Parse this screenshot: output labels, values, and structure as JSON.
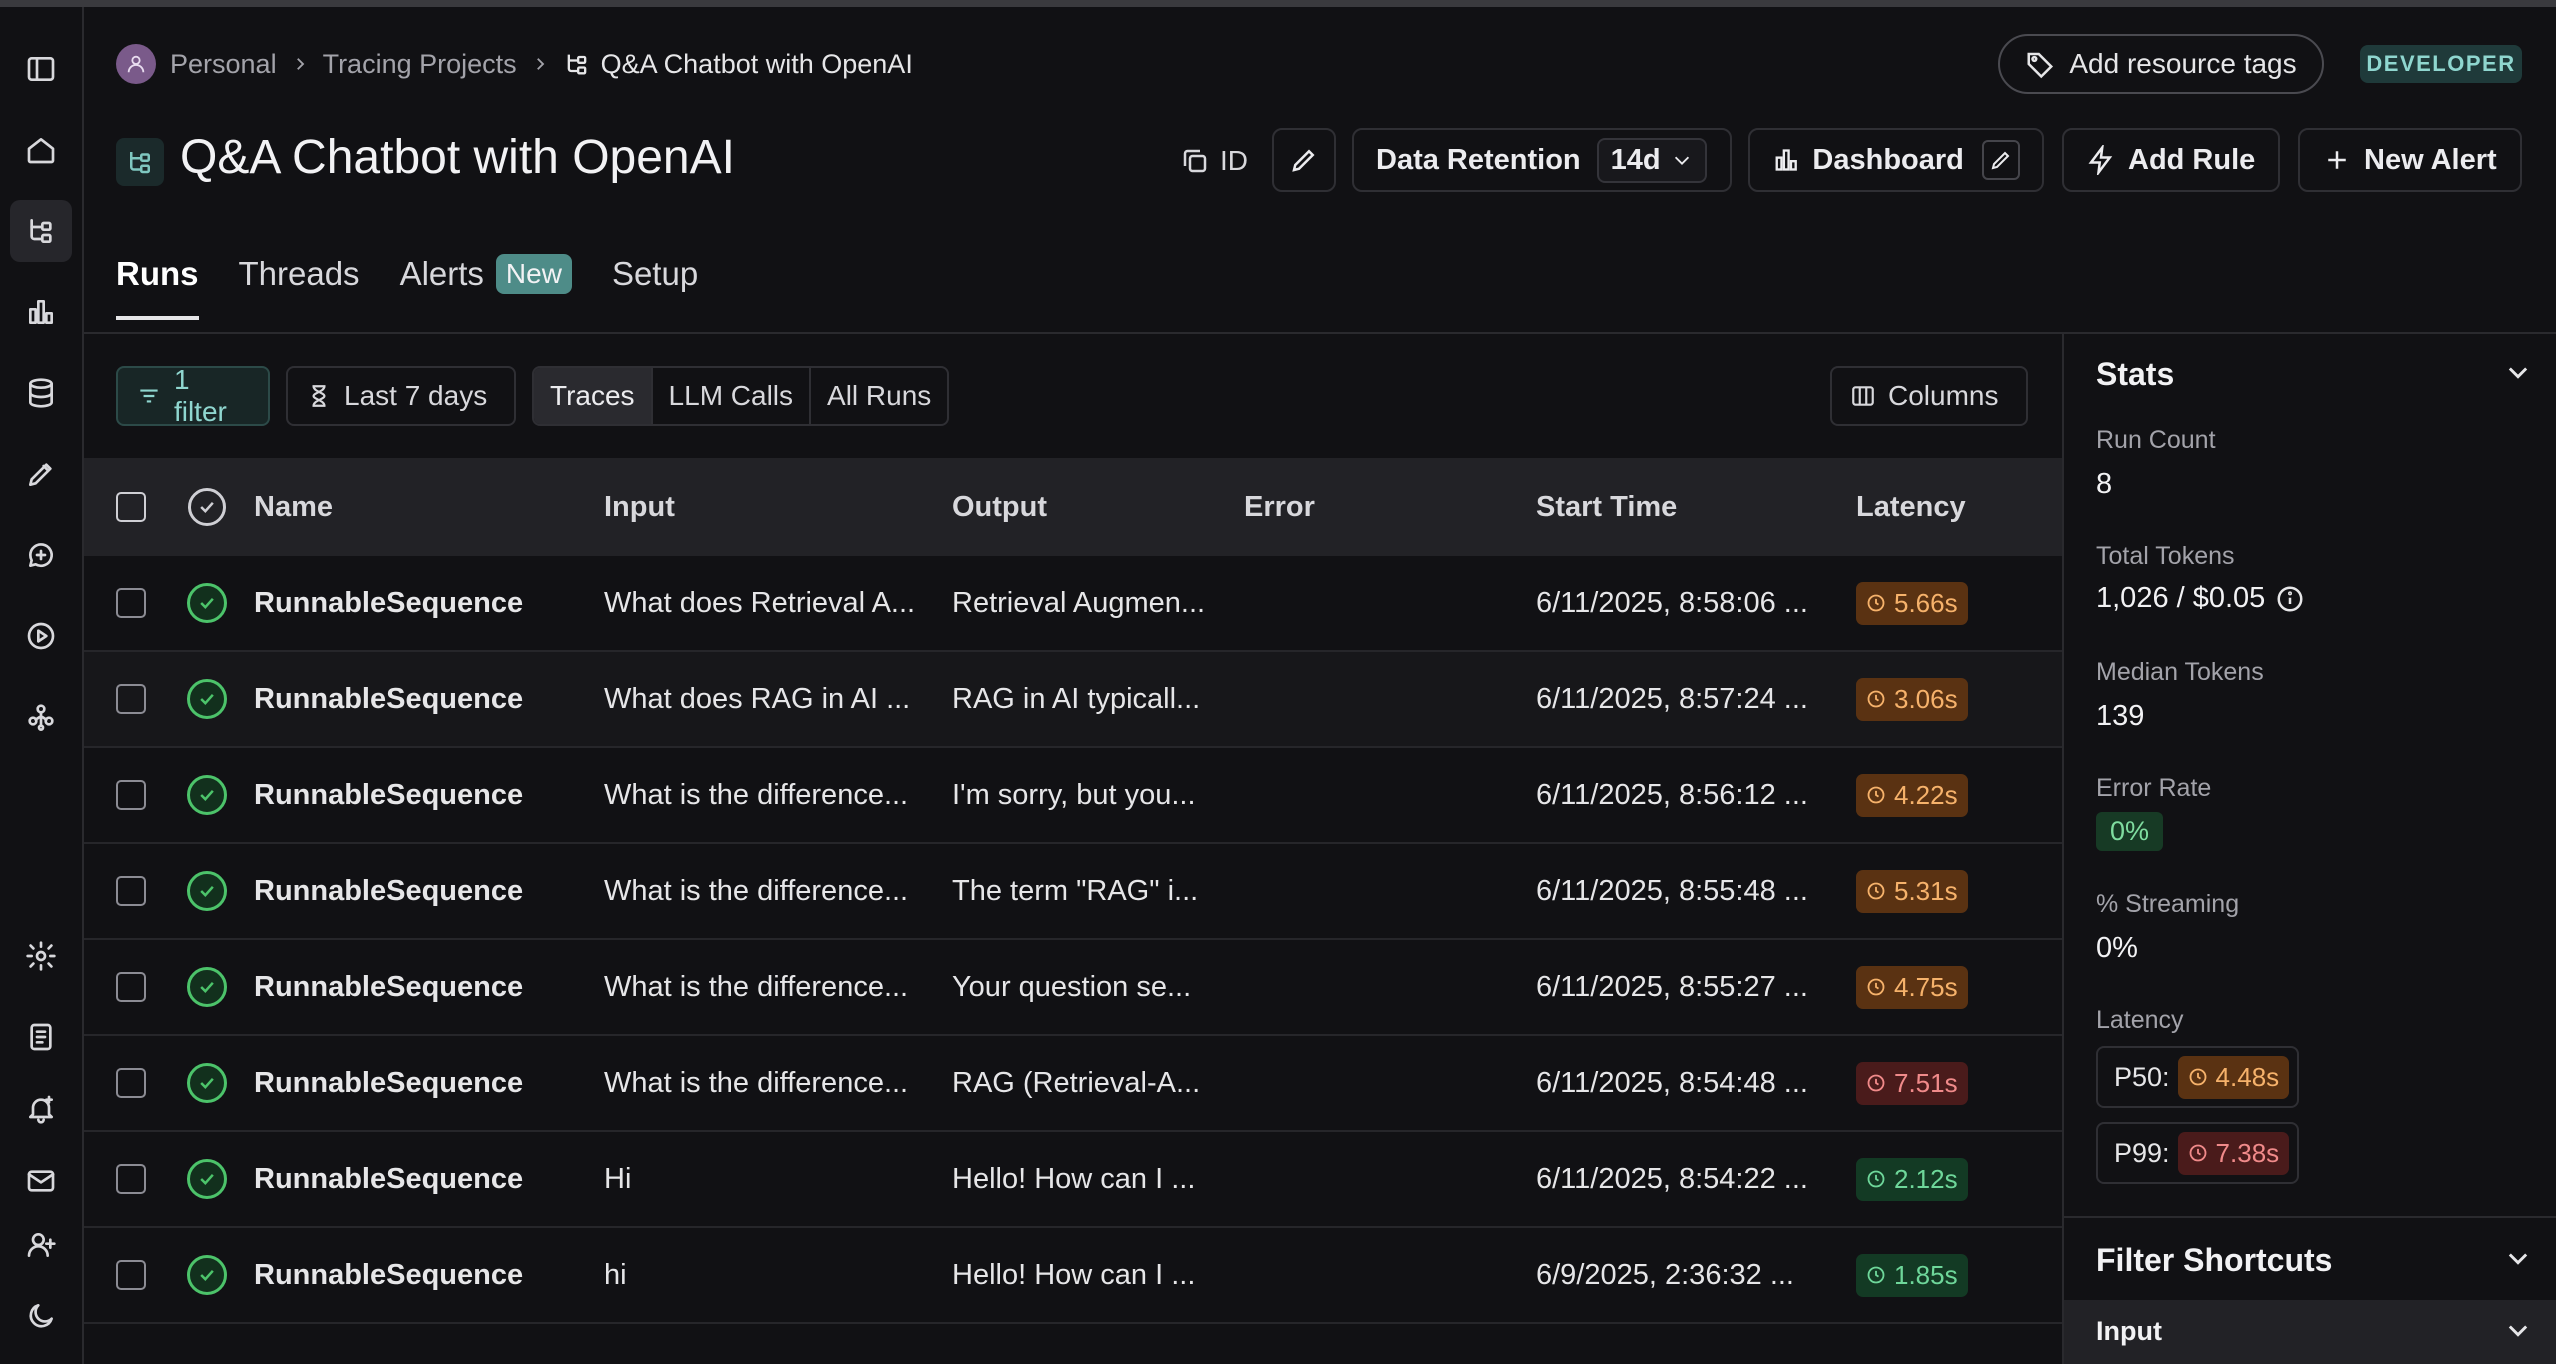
{
  "breadcrumb": {
    "workspace": "Personal",
    "section": "Tracing Projects",
    "current": "Q&A Chatbot with OpenAI"
  },
  "header": {
    "add_tags_label": "Add resource tags",
    "role_badge": "DEVELOPER",
    "title": "Q&A Chatbot with OpenAI",
    "id_label": "ID",
    "retention_label": "Data Retention",
    "retention_value": "14d",
    "dashboard_label": "Dashboard",
    "add_rule_label": "Add Rule",
    "new_alert_label": "New Alert"
  },
  "tabs": [
    {
      "label": "Runs",
      "active": true
    },
    {
      "label": "Threads"
    },
    {
      "label": "Alerts",
      "badge": "New"
    },
    {
      "label": "Setup"
    }
  ],
  "toolbar": {
    "filter_label": "1 filter",
    "time_label": "Last 7 days",
    "views": [
      "Traces",
      "LLM Calls",
      "All Runs"
    ],
    "columns_label": "Columns"
  },
  "table": {
    "columns": [
      "Name",
      "Input",
      "Output",
      "Error",
      "Start Time",
      "Latency"
    ],
    "rows": [
      {
        "name": "RunnableSequence",
        "input": "What does Retrieval A...",
        "output": "Retrieval Augmen...",
        "error": "",
        "start": "6/11/2025, 8:58:06 ...",
        "latency": "5.66s",
        "level": "orange"
      },
      {
        "name": "RunnableSequence",
        "input": "What does RAG in AI ...",
        "output": "RAG in AI typicall...",
        "error": "",
        "start": "6/11/2025, 8:57:24 ...",
        "latency": "3.06s",
        "level": "orange"
      },
      {
        "name": "RunnableSequence",
        "input": "What is the difference...",
        "output": "I'm sorry, but you...",
        "error": "",
        "start": "6/11/2025, 8:56:12 ...",
        "latency": "4.22s",
        "level": "orange"
      },
      {
        "name": "RunnableSequence",
        "input": "What is the difference...",
        "output": "The term \"RAG\" i...",
        "error": "",
        "start": "6/11/2025, 8:55:48 ...",
        "latency": "5.31s",
        "level": "orange"
      },
      {
        "name": "RunnableSequence",
        "input": "What is the difference...",
        "output": "Your question se...",
        "error": "",
        "start": "6/11/2025, 8:55:27 ...",
        "latency": "4.75s",
        "level": "orange"
      },
      {
        "name": "RunnableSequence",
        "input": "What is the difference...",
        "output": "RAG (Retrieval-A...",
        "error": "",
        "start": "6/11/2025, 8:54:48 ...",
        "latency": "7.51s",
        "level": "red"
      },
      {
        "name": "RunnableSequence",
        "input": "Hi",
        "output": "Hello! How can I ...",
        "error": "",
        "start": "6/11/2025, 8:54:22 ...",
        "latency": "2.12s",
        "level": "green"
      },
      {
        "name": "RunnableSequence",
        "input": "hi",
        "output": "Hello! How can I ...",
        "error": "",
        "start": "6/9/2025, 2:36:32 ...",
        "latency": "1.85s",
        "level": "green"
      }
    ]
  },
  "stats": {
    "title": "Stats",
    "run_count_label": "Run Count",
    "run_count": "8",
    "total_tokens_label": "Total Tokens",
    "total_tokens": "1,026 / $0.05",
    "median_tokens_label": "Median Tokens",
    "median_tokens": "139",
    "error_rate_label": "Error Rate",
    "error_rate": "0%",
    "streaming_label": "% Streaming",
    "streaming": "0%",
    "latency_label": "Latency",
    "p50_label": "P50:",
    "p50": "4.48s",
    "p99_label": "P99:",
    "p99": "7.38s"
  },
  "filter_shortcuts": {
    "title": "Filter Shortcuts",
    "first_item": "Input"
  },
  "colors": {
    "accent_teal": "#8fd6cf",
    "latency_orange": "#f6b26b",
    "latency_red": "#f08a8a",
    "latency_green": "#6ed79a",
    "success_green": "#4cc36a"
  }
}
